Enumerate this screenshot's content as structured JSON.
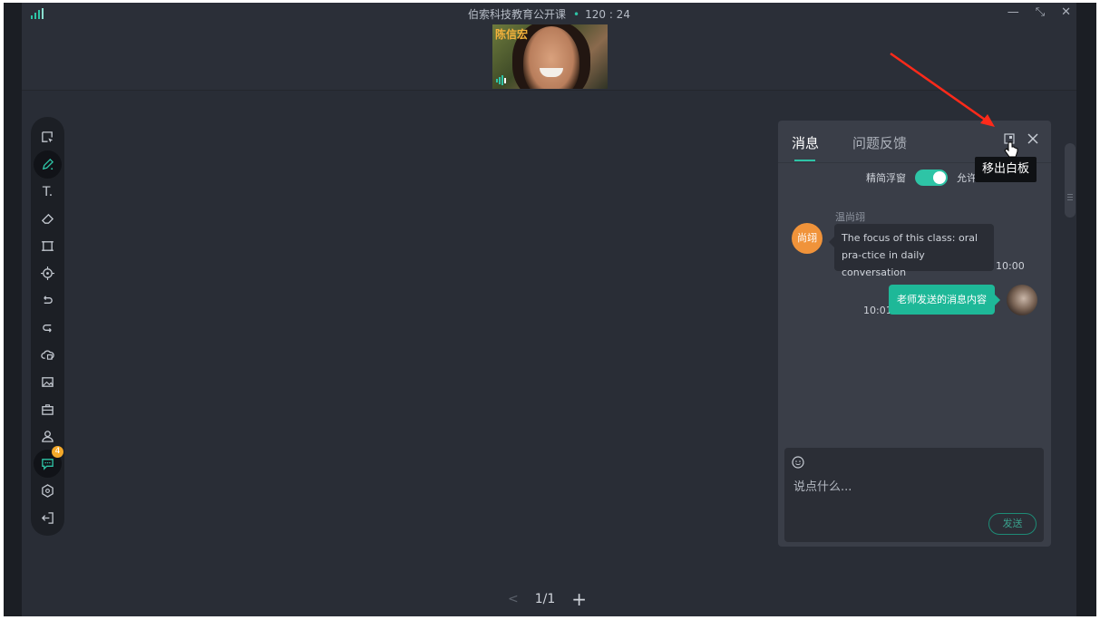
{
  "app": {
    "title": "伯索科技教育公开课",
    "timer": "120 : 24",
    "window_controls": {
      "minimize": "—",
      "restore": "⤡",
      "close": "✕"
    }
  },
  "video": {
    "participant_name": "陈信宏"
  },
  "toolbar": {
    "items": [
      {
        "icon": "select-icon"
      },
      {
        "icon": "pen-icon",
        "active": true
      },
      {
        "icon": "text-icon",
        "glyph": "T."
      },
      {
        "icon": "eraser-icon"
      },
      {
        "icon": "shape-icon"
      },
      {
        "icon": "laser-pointer-icon"
      },
      {
        "icon": "undo-icon"
      },
      {
        "icon": "redo-icon"
      },
      {
        "icon": "cloud-upload-icon"
      },
      {
        "icon": "image-icon"
      },
      {
        "icon": "toolbox-icon"
      },
      {
        "icon": "user-icon"
      },
      {
        "icon": "chat-icon",
        "active": true,
        "badge": "4"
      },
      {
        "icon": "settings-icon"
      },
      {
        "icon": "exit-icon"
      }
    ]
  },
  "pager": {
    "prev": "<",
    "current": "1/1",
    "add": "+"
  },
  "chat_panel": {
    "tabs": [
      {
        "label": "消息",
        "active": true
      },
      {
        "label": "问题反馈",
        "active": false
      }
    ],
    "tooltip": "移出白板",
    "simple_mode_label": "精简浮窗",
    "simple_mode_on": true,
    "allow_label": "允许",
    "messages": [
      {
        "sender": "温尚翊",
        "avatar_text": "尚翊",
        "text": "The focus of this class: oral pra-ctice in daily conversation",
        "time": "10:00",
        "direction": "in"
      },
      {
        "sender": "",
        "text": "老师发送的消息内容",
        "time": "10:01",
        "direction": "out"
      }
    ],
    "input_placeholder": "说点什么...",
    "send_label": "发送"
  },
  "colors": {
    "accent": "#2ec4a6",
    "badge": "#f4a92a",
    "avatar": "#f0933a",
    "annotation_arrow": "#ff2a1a"
  }
}
